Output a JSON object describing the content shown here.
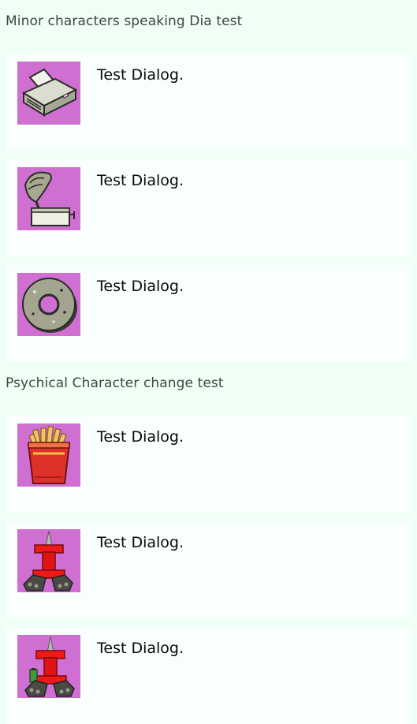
{
  "sections": [
    {
      "title": "Minor characters speaking Dia test",
      "items": [
        {
          "avatar": "printer-icon",
          "text": "Test Dialog."
        },
        {
          "avatar": "gramophone-icon",
          "text": "Test Dialog."
        },
        {
          "avatar": "donut-icon",
          "text": "Test Dialog."
        }
      ]
    },
    {
      "title": "Psychical Character change test",
      "items": [
        {
          "avatar": "fries-icon",
          "text": "Test Dialog."
        },
        {
          "avatar": "pushpin-character-icon",
          "text": "Test Dialog."
        },
        {
          "avatar": "pushpin-battery-character-icon",
          "text": "Test Dialog."
        }
      ]
    }
  ],
  "colors": {
    "page_background": "#f0fff6",
    "card_background": "#f8fffc",
    "avatar_background": "#cf6fd1",
    "section_title": "#3e4744",
    "dialog_text": "#0a0a0a"
  }
}
